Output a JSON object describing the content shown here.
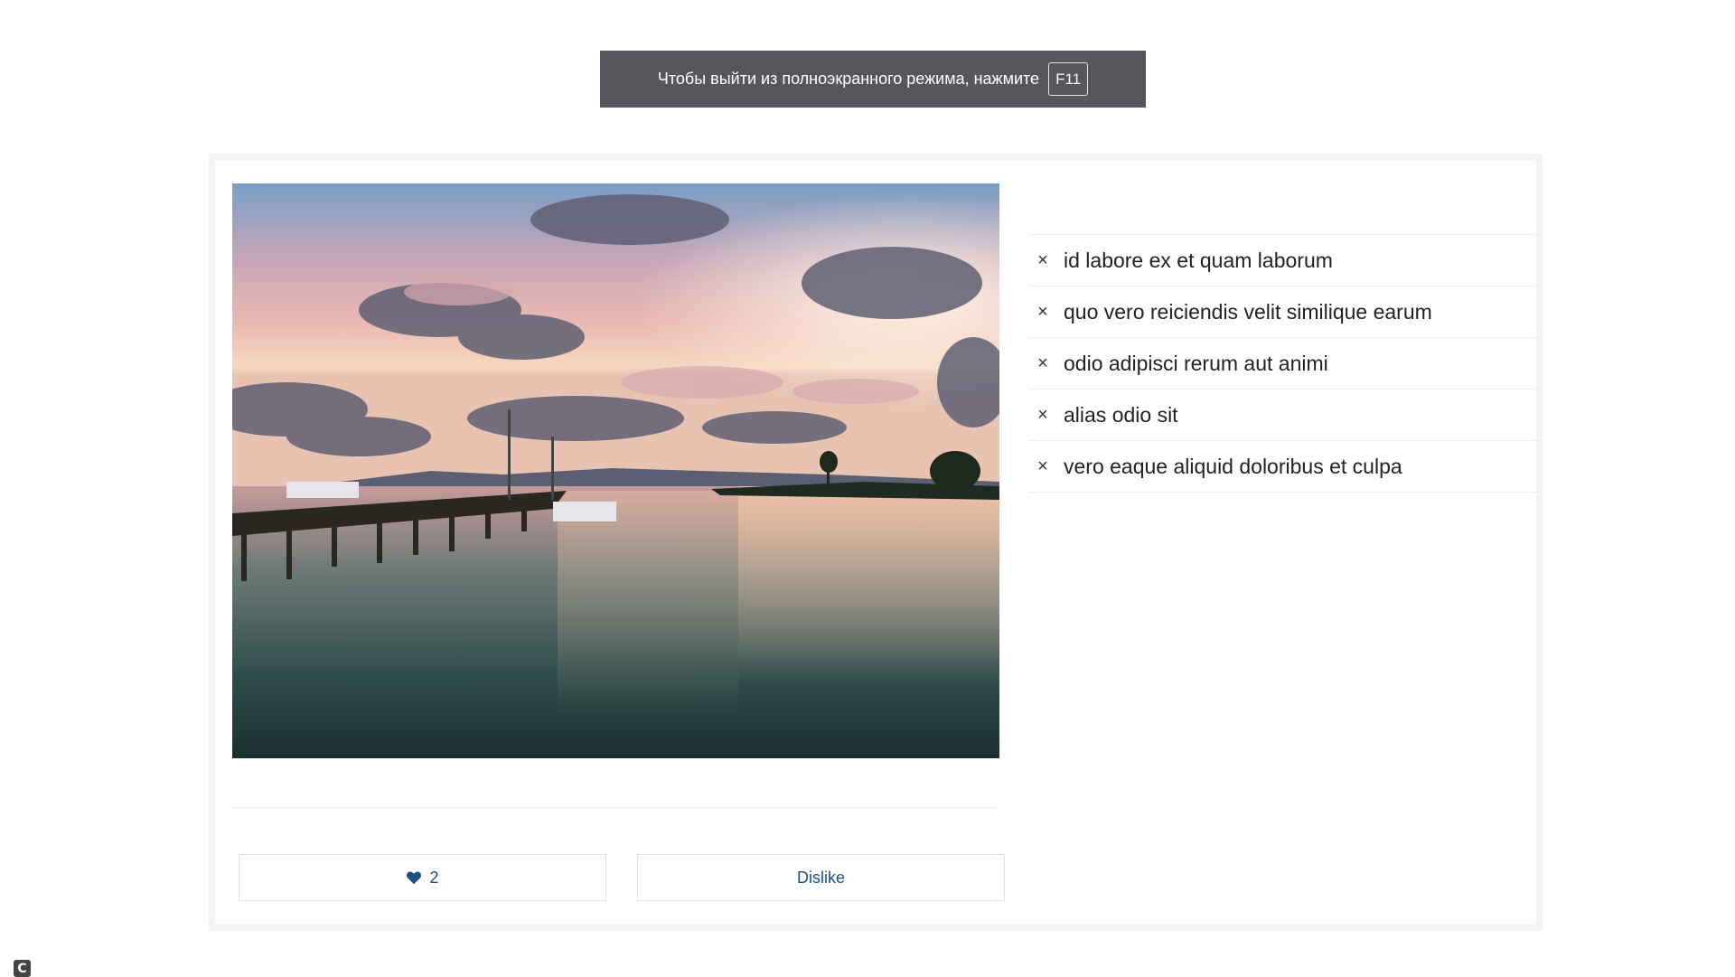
{
  "fullscreen_notice": {
    "text": "Чтобы выйти из полноэкранного режима, нажмите",
    "key": "F11"
  },
  "image": {
    "description_icon": "sunset-pier-photo"
  },
  "actions": {
    "like_icon": "heart-icon",
    "like_count": "2",
    "dislike_label": "Dislike"
  },
  "list": {
    "remove_glyph": "×",
    "items": [
      {
        "label": "id labore ex et quam laborum"
      },
      {
        "label": "quo vero reiciendis velit similique earum"
      },
      {
        "label": "odio adipisci rerum aut animi"
      },
      {
        "label": "alias odio sit"
      },
      {
        "label": "vero eaque aliquid doloribus et culpa"
      }
    ]
  },
  "corner_badge": {
    "glyph": "C"
  },
  "colors": {
    "accent": "#1d4f82",
    "toast_bg": "#55575c"
  }
}
